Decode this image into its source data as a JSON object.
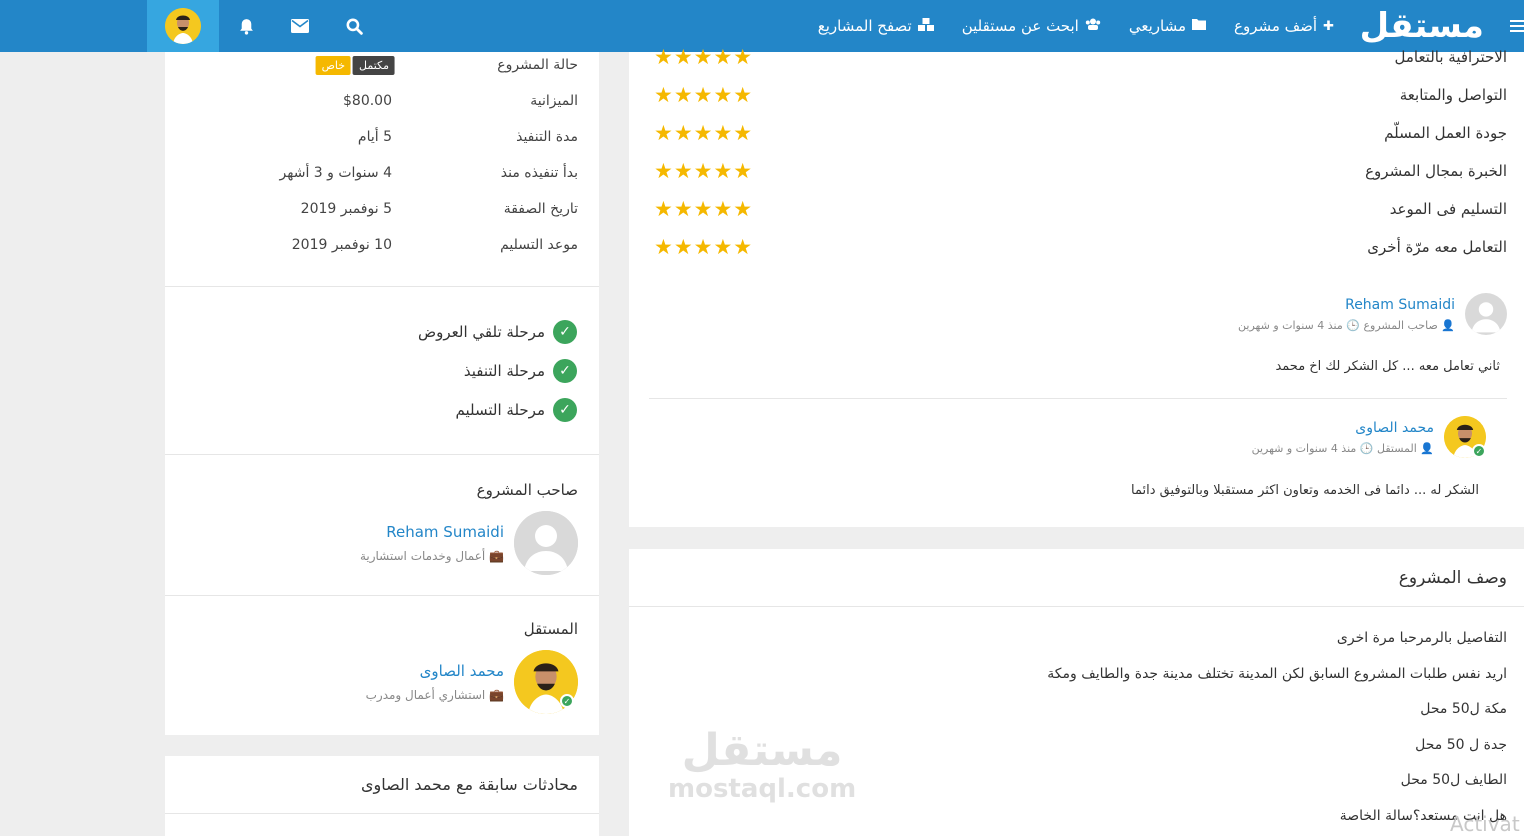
{
  "nav": {
    "brand": "مستقل",
    "links": [
      {
        "icon": "plus-icon",
        "label": "أضف مشروع"
      },
      {
        "icon": "folder-icon",
        "label": "مشاريعي"
      },
      {
        "icon": "users-icon",
        "label": "ابحث عن مستقلين"
      },
      {
        "icon": "cubes-icon",
        "label": "تصفح المشاريع"
      }
    ]
  },
  "project_meta": {
    "status_label": "حالة المشروع",
    "status_badges": [
      "مكتمل",
      "خاص"
    ],
    "rows": [
      {
        "key": "الميزانية",
        "value": "$80.00"
      },
      {
        "key": "مدة التنفيذ",
        "value": "5 أيام"
      },
      {
        "key": "بدأ تنفيذه منذ",
        "value": "4 سنوات و 3 أشهر"
      },
      {
        "key": "تاريخ الصفقة",
        "value": "5 نوفمبر 2019"
      },
      {
        "key": "موعد التسليم",
        "value": "10 نوفمبر 2019"
      }
    ]
  },
  "stages": [
    "مرحلة تلقي العروض",
    "مرحلة التنفيذ",
    "مرحلة التسليم"
  ],
  "owner": {
    "title": "صاحب المشروع",
    "name": "Reham Sumaidi",
    "sub": "أعمال وخدمات استشارية"
  },
  "freelancer": {
    "title": "المستقل",
    "name": "محمد الصاوى",
    "sub": "استشاري أعمال ومدرب"
  },
  "previous": {
    "title": "محادثات سابقة مع محمد الصاوى"
  },
  "ratings": [
    {
      "label": "الاحترافية بالتعامل",
      "stars": 5
    },
    {
      "label": "التواصل والمتابعة",
      "stars": 5
    },
    {
      "label": "جودة العمل المسلّم",
      "stars": 5
    },
    {
      "label": "الخبرة بمجال المشروع",
      "stars": 5
    },
    {
      "label": "التسليم فى الموعد",
      "stars": 5
    },
    {
      "label": "التعامل معه مرّة أخرى",
      "stars": 5
    }
  ],
  "reviews": [
    {
      "name": "Reham Sumaidi",
      "role": "صاحب المشروع",
      "time": "منذ 4 سنوات و شهرين",
      "text": "ثاني تعامل معه ... كل الشكر لك اخ محمد"
    },
    {
      "name": "محمد الصاوى",
      "role": "المستقل",
      "time": "منذ 4 سنوات و شهرين",
      "text": "الشكر له ... دائما فى الخدمه وتعاون اكثر مستقبلا وبالتوفيق دائما"
    }
  ],
  "description": {
    "title": "وصف المشروع",
    "lines": [
      "التفاصيل بالرمرحبا مرة اخرى",
      "اريد نفس طلبات المشروع السابق لكن المدينة تختلف مدينة جدة والطايف ومكة",
      "مكة ل50 محل",
      "جدة ل 50 محل",
      "الطايف ل50 محل",
      "هل انت مستعد؟سالة الخاصة"
    ]
  },
  "watermark": {
    "logo": "مستقل",
    "domain": "mostaql.com"
  },
  "activate_text": "Activat",
  "colors": {
    "brand": "#2386c8",
    "star": "#f5b800",
    "success": "#3ca55c"
  }
}
